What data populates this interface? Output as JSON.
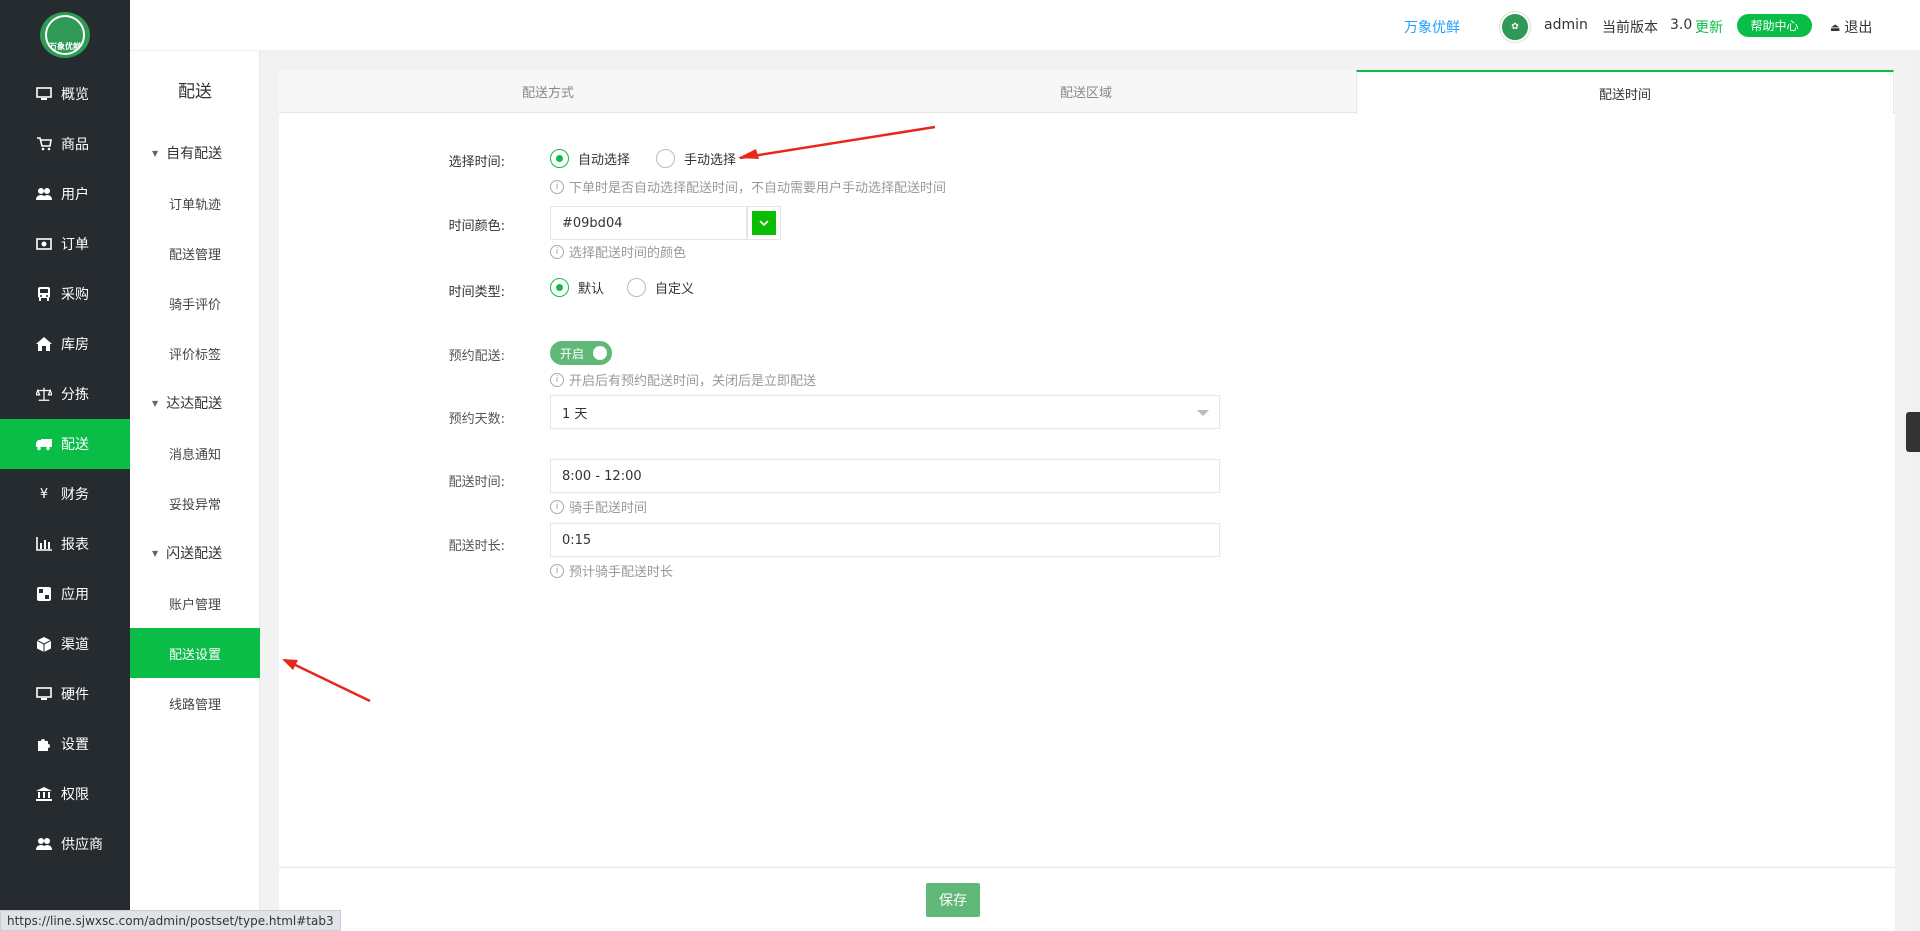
{
  "brand": {
    "logo_text": "万象优鲜"
  },
  "header": {
    "brand_link": "万象优鲜",
    "user": "admin",
    "version_label": "当前版本",
    "version": "3.0",
    "update": "更新",
    "help": "帮助中心",
    "logout": "退出"
  },
  "nav": [
    {
      "label": "概览",
      "icon": "monitor-icon"
    },
    {
      "label": "商品",
      "icon": "cart-icon"
    },
    {
      "label": "用户",
      "icon": "users-icon"
    },
    {
      "label": "订单",
      "icon": "money-icon"
    },
    {
      "label": "采购",
      "icon": "bus-icon"
    },
    {
      "label": "库房",
      "icon": "home-icon"
    },
    {
      "label": "分拣",
      "icon": "scale-icon"
    },
    {
      "label": "配送",
      "icon": "truck-icon",
      "active": true
    },
    {
      "label": "财务",
      "icon": "yen-icon"
    },
    {
      "label": "报表",
      "icon": "bar-chart-icon"
    },
    {
      "label": "应用",
      "icon": "apps-icon"
    },
    {
      "label": "渠道",
      "icon": "cube-icon"
    },
    {
      "label": "硬件",
      "icon": "desktop-icon"
    },
    {
      "label": "设置",
      "icon": "puzzle-icon"
    },
    {
      "label": "权限",
      "icon": "bank-icon"
    },
    {
      "label": "供应商",
      "icon": "users-icon"
    }
  ],
  "subnav": {
    "title": "配送",
    "groups": [
      {
        "label": "自有配送",
        "items": [
          "订单轨迹",
          "配送管理",
          "骑手评价",
          "评价标签"
        ]
      },
      {
        "label": "达达配送",
        "items": [
          "消息通知",
          "妥投异常"
        ]
      },
      {
        "label": "闪送配送",
        "items": [
          "账户管理",
          "配送设置",
          "线路管理"
        ]
      }
    ],
    "active_item": "配送设置"
  },
  "tabs": [
    "配送方式",
    "配送区域",
    "配送时间"
  ],
  "active_tab": "配送时间",
  "form": {
    "select_time": {
      "label": "选择时间:",
      "options": [
        "自动选择",
        "手动选择"
      ],
      "selected": "自动选择",
      "hint": "下单时是否自动选择配送时间，不自动需要用户手动选择配送时间"
    },
    "time_color": {
      "label": "时间颜色:",
      "value": "#09bd04",
      "hint": "选择配送时间的颜色"
    },
    "time_type": {
      "label": "时间类型:",
      "options": [
        "默认",
        "自定义"
      ],
      "selected": "默认"
    },
    "reserve": {
      "label": "预约配送:",
      "switch_label": "开启",
      "enabled": true,
      "hint": "开启后有预约配送时间，关闭后是立即配送"
    },
    "reserve_days": {
      "label": "预约天数:",
      "value": "1 天"
    },
    "delivery_time": {
      "label": "配送时间:",
      "value": "8:00 - 12:00",
      "hint": "骑手配送时间"
    },
    "delivery_duration": {
      "label": "配送时长:",
      "value": "0:15",
      "hint": "预计骑手配送时长"
    }
  },
  "save_label": "保存",
  "status_url": "https://line.sjwxsc.com/admin/postset/type.html#tab3",
  "colors": {
    "accent": "#09bd47",
    "switch": "#5fb878",
    "link": "#1e9fff",
    "nav_bg": "#262b30"
  }
}
